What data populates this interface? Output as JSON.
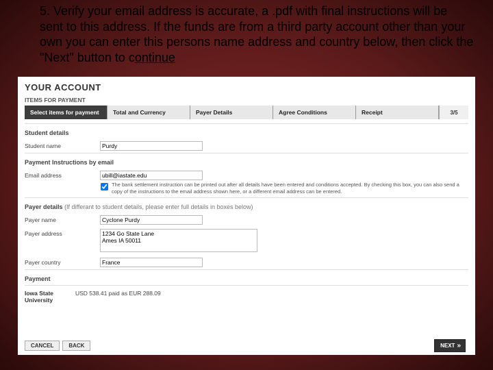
{
  "instruction": {
    "text_plain": "5. Verify your email address is accurate, a .pdf with final instructions will be sent to this address. If the funds are from a third party account other than your own you can enter this persons name address and country below, then click the \"Next\" button to continue",
    "underlined_tail": "ontinue"
  },
  "account": {
    "heading": "YOUR ACCOUNT",
    "items_label": "ITEMS FOR PAYMENT"
  },
  "wizard": {
    "steps": [
      {
        "label": "Select items for payment",
        "current": true
      },
      {
        "label": "Total and Currency",
        "current": false
      },
      {
        "label": "Payer Details",
        "current": false
      },
      {
        "label": "Agree Conditions",
        "current": false
      },
      {
        "label": "Receipt",
        "current": false
      }
    ],
    "page_indicator": "3/5"
  },
  "student": {
    "section": "Student details",
    "name_label": "Student name",
    "name_value": "Purdy"
  },
  "email": {
    "section": "Payment Instructions by email",
    "label": "Email address",
    "value": "ubill@iastate.edu",
    "checkbox_checked": true,
    "checkbox_text": "The bank settlement instruction can be printed out after all details have been entered and conditions accepted. By checking this box, you can also send a copy of the instructions to the email address shown here, or a different email address can be entered."
  },
  "payer": {
    "section": "Payer details",
    "section_hint": "(If differant to student details, please enter full details in boxes below)",
    "name_label": "Payer name",
    "name_value": "Cyclone Purdy",
    "address_label": "Payer address",
    "address_value": "1234 Go State Lane\nAmes IA 50011",
    "country_label": "Payer country",
    "country_value": "France"
  },
  "payment": {
    "section": "Payment",
    "university": "Iowa State University",
    "amount": "USD 538.41 paid as EUR 288.09"
  },
  "buttons": {
    "cancel": "CANCEL",
    "back": "BACK",
    "next": "NEXT"
  }
}
